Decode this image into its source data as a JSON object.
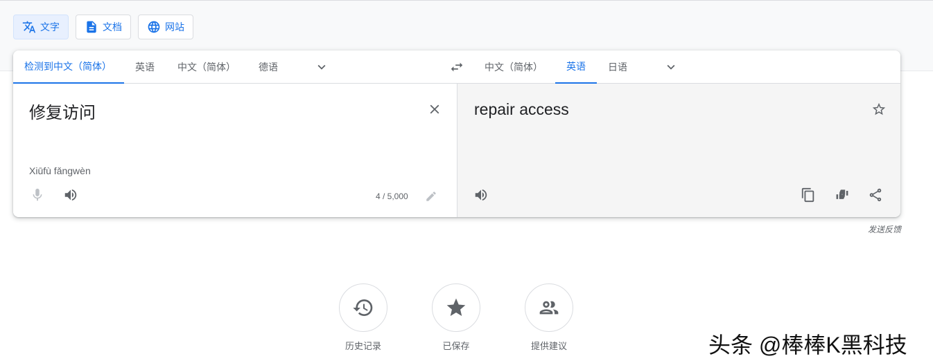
{
  "modes": {
    "text_label": "文字",
    "docs_label": "文档",
    "websites_label": "网站"
  },
  "source_langs": {
    "detected": "检测到中文（简体）",
    "english": "英语",
    "chinese_simplified": "中文（简体）",
    "german": "德语"
  },
  "target_langs": {
    "chinese_simplified": "中文（简体）",
    "english": "英语",
    "japanese": "日语"
  },
  "source": {
    "text": "修复访问",
    "transliteration": "Xiūfù fǎngwèn",
    "char_count": "4 / 5,000"
  },
  "target": {
    "text": "repair access"
  },
  "feedback_label": "发送反馈",
  "bottom_actions": {
    "history_label": "历史记录",
    "saved_label": "已保存",
    "contribute_label": "提供建议"
  },
  "watermark": "头条 @棒棒K黑科技",
  "colors": {
    "accent": "#1a73e8",
    "icon": "#5f6368",
    "target_bg": "#f5f5f5"
  },
  "icons": {
    "text_mode": "translate-icon",
    "docs_mode": "document-icon",
    "web_mode": "globe-icon",
    "swap": "swap-icon",
    "clear": "close-icon",
    "star": "star-outline-icon",
    "mic": "mic-icon",
    "speaker": "volume-icon",
    "edit": "pencil-icon",
    "copy": "copy-icon",
    "rate": "thumbs-icon",
    "share": "share-icon",
    "history": "history-icon",
    "saved": "star-icon",
    "contribute": "people-icon"
  }
}
